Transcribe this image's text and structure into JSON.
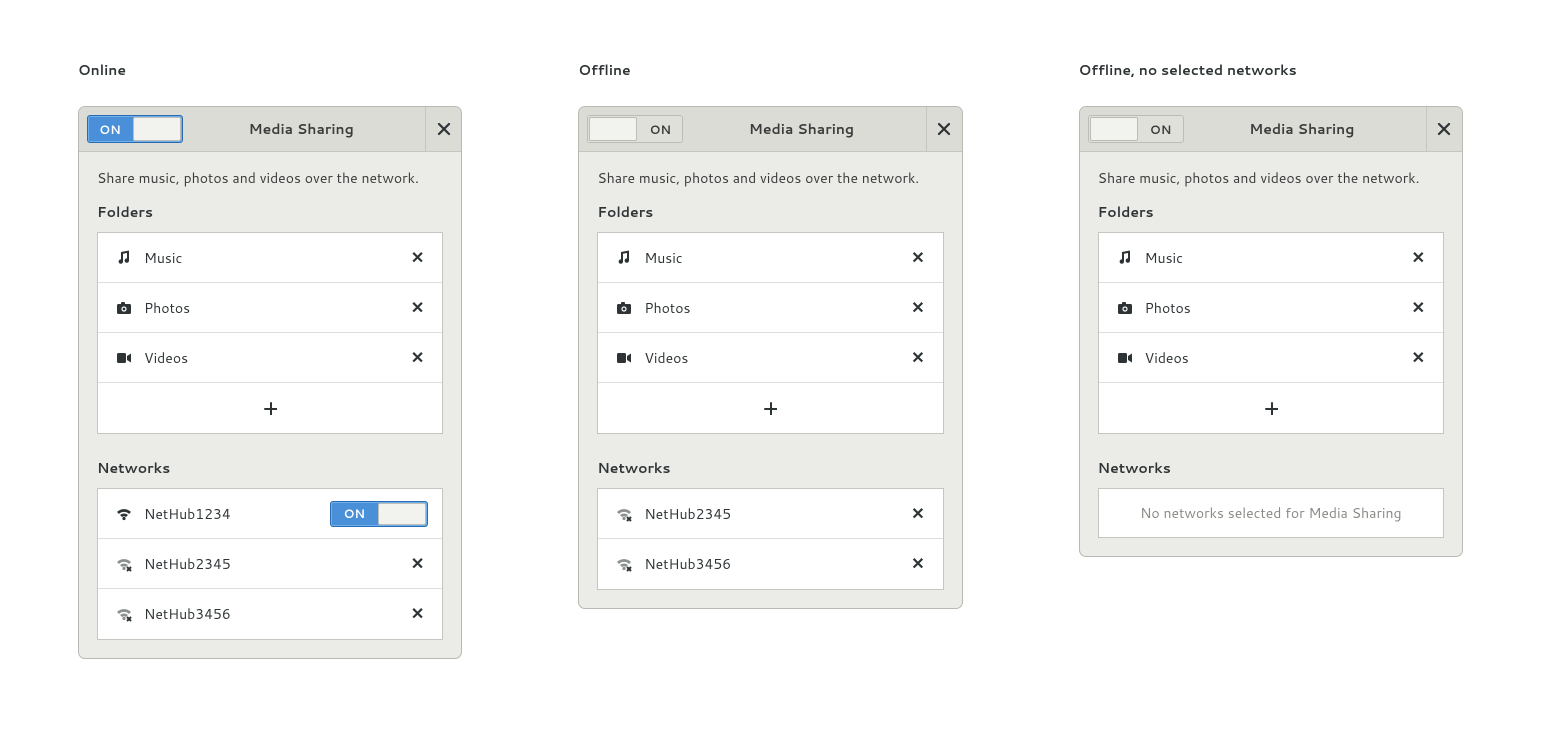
{
  "captions": {
    "online": "Online",
    "offline": "Offline",
    "offline_none": "Offline, no selected networks"
  },
  "dialog": {
    "title": "Media Sharing",
    "switch_on_label": "ON",
    "switch_off_label": "ON",
    "description": "Share music, photos and videos over the network.",
    "folders_label": "Folders",
    "networks_label": "Networks",
    "folders": [
      {
        "icon": "music",
        "name": "Music"
      },
      {
        "icon": "photos",
        "name": "Photos"
      },
      {
        "icon": "videos",
        "name": "Videos"
      }
    ],
    "networks_online": [
      {
        "name": "NetHub1234",
        "connected": true,
        "switch_label": "ON"
      },
      {
        "name": "NetHub2345",
        "connected": false
      },
      {
        "name": "NetHub3456",
        "connected": false
      }
    ],
    "networks_offline": [
      {
        "name": "NetHub2345",
        "connected": false
      },
      {
        "name": "NetHub3456",
        "connected": false
      }
    ],
    "no_networks_text": "No networks selected for Media Sharing"
  }
}
